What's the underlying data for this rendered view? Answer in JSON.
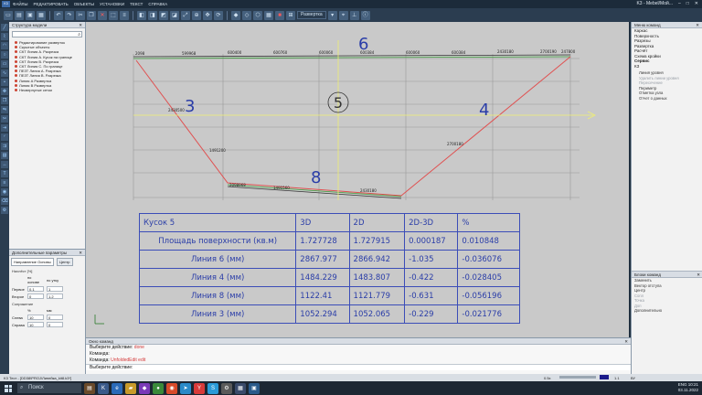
{
  "titlebar": {
    "logo": "K3",
    "menu": [
      "ФАЙЛЫ",
      "РЕДАКТИРОВАТЬ",
      "ОБЪЕКТЫ",
      "УСТАНОВКИ",
      "ТЕКСТ",
      "СПРАВКА"
    ],
    "right_label": "K3 - Mebel/Мой..."
  },
  "toolbar": {
    "dropdown_label": "Развертка"
  },
  "tree": {
    "title": "Структура модели",
    "items": [
      "Редактирование разверток",
      "Скрытые объекты",
      "СКТ Линия А. Разрезка",
      "СКТ Линия А. Кусок на границе",
      "СКТ Линия В. Разрезка",
      "СКТ Линия С. По границе",
      "ПЕЗТ Линия А. Разрезка",
      "ПЕЗТ Линия В. Разрезка",
      "Линия А Развертка",
      "Линия В Развертка",
      "Несвернутые сетки"
    ]
  },
  "params": {
    "title": "Дополнительные параметры",
    "tab_active": "Направление Основы",
    "tab2": "Центр",
    "group1": "Нахлёст [%]",
    "col1": "по основе",
    "col2": "по утку",
    "row1_label": "Первое",
    "row1_a": "0.1",
    "row1_b": "1",
    "row2_label": "Второе",
    "row2_a": "0",
    "row2_b": "1.2",
    "group2": "Сопряжение",
    "col3": "%",
    "col4": "мм",
    "row3_label": "Слева",
    "row3_a": "10",
    "row3_b": "0",
    "row4_label": "Справа",
    "row4_a": "10",
    "row4_b": "0"
  },
  "drawing": {
    "big_labels": {
      "l3": "3",
      "l4": "4",
      "l5": "5",
      "l6": "6",
      "l8": "8"
    },
    "top_dims": [
      "2098",
      "599968",
      "600400",
      "600760",
      "600060",
      "600384",
      "600060",
      "600384",
      "2430180",
      "2700190"
    ],
    "small_dims": [
      "2430500",
      "1491200",
      "2098968",
      "1491560",
      "2430180",
      "2700180",
      "247800"
    ]
  },
  "table": {
    "header": [
      "Кусок 5",
      "3D",
      "2D",
      "2D-3D",
      "%"
    ],
    "rows": [
      [
        "Площадь поверхности (кв.м)",
        "1.727728",
        "1.727915",
        "0.000187",
        "0.010848"
      ],
      [
        "Линия 6 (мм)",
        "2867.977",
        "2866.942",
        "-1.035",
        "-0.036076"
      ],
      [
        "Линия 4 (мм)",
        "1484.229",
        "1483.807",
        "-0.422",
        "-0.028405"
      ],
      [
        "Линия 8 (мм)",
        "1122.41",
        "1121.779",
        "-0.631",
        "-0.056196"
      ],
      [
        "Линия 3 (мм)",
        "1052.294",
        "1052.065",
        "-0.229",
        "-0.021776"
      ]
    ]
  },
  "right": {
    "title": "Меню команд",
    "items": [
      "Каркас",
      "Поверхность",
      "Разрезы",
      "Развертка",
      "Расчёт",
      "Схема кройки",
      "Сервис",
      "КЗ"
    ],
    "subitems": [
      "Линия уровня",
      "Удалить линии уровня",
      "Пересечение",
      "Периметр",
      "Отметка узла",
      "Отчет о данных"
    ],
    "subitems_dim": [
      false,
      true,
      true,
      false,
      false,
      false
    ],
    "panel2_title": "Блоки команд",
    "panel2_items": [
      "Заменить",
      "Вектор отступа",
      "Центр",
      "Сопл",
      "Точка",
      "Доп",
      "Дополнительно"
    ],
    "panel2_dim": [
      false,
      false,
      false,
      true,
      true,
      true,
      false
    ]
  },
  "cmd": {
    "title": "Окно команд",
    "line1_prefix": "Выберите действие: ",
    "line1_value": "done",
    "line2": "Команда:",
    "line3_prefix": "Команда: ",
    "line3_value": "UnfoldedEdit edit",
    "line4": "Выберите действие:"
  },
  "status": {
    "left": "K3 Тест - [DD38\\PROJ\\Линейка_kit8.k3*]",
    "scale": "0.5x",
    "coords": "1.1",
    "mode": "ВУ"
  },
  "taskbar": {
    "search": "Поиск",
    "time": "10:21",
    "date": "03.11.2022",
    "lang": "ENG"
  },
  "colors": {
    "accent": "#2a3da8",
    "red_line": "#e05050",
    "green_line": "#3a9a3a",
    "yellow_axis": "#f0f070"
  }
}
